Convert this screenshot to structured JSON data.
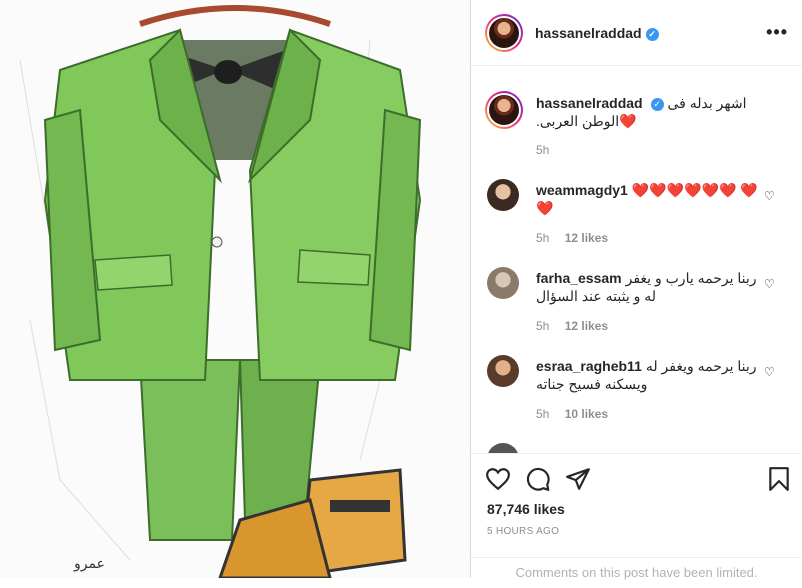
{
  "post": {
    "username": "hassanelraddad",
    "caption_text": "اشهر بدله فى الوطن العربى.",
    "caption_emoji": "❤️",
    "caption_age": "5h",
    "likes": "87,746 likes",
    "posted": "5 HOURS AGO",
    "comments_notice": "Comments on this post have been limited."
  },
  "comments": [
    {
      "username": "weammagdy1",
      "text": "❤️❤️❤️❤️❤️❤️ ❤️❤️",
      "age": "5h",
      "likes": "12 likes"
    },
    {
      "username": "farha_essam",
      "text": "ربنا يرحمه يارب و يغفر له و يثبته عند السؤال",
      "age": "5h",
      "likes": "12 likes"
    },
    {
      "username": "esraa_ragheb11",
      "text": "ربنا يرحمه ويغفر له ويسكنه فسيح جناته",
      "age": "5h",
      "likes": "10 likes"
    }
  ],
  "colors": {
    "verified": "#3897f0",
    "heart": "#ed1c24",
    "suit": "#7fc45a"
  }
}
